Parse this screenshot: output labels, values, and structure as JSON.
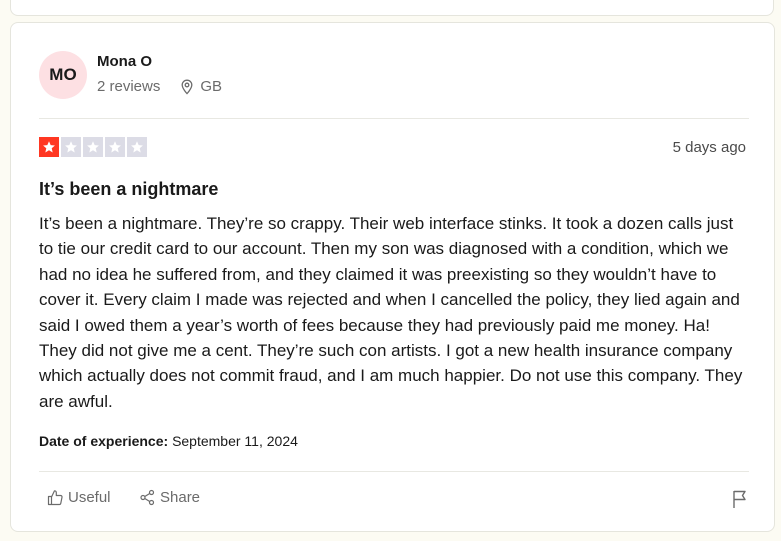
{
  "reviewer": {
    "initials": "MO",
    "name": "Mona O",
    "reviews": "2 reviews",
    "country": "GB"
  },
  "review": {
    "rating": 1,
    "rating_max": 5,
    "posted": "5 days ago",
    "title": "It’s been a nightmare",
    "body": "It’s been a nightmare. They’re so crappy. Their web interface stinks. It took a dozen calls just to tie our credit card to our account. Then my son was diagnosed with a condition, which we had no idea he suffered from, and they claimed it was preexisting so they wouldn’t have to cover it. Every claim I made was rejected and when I cancelled the policy, they lied again and said I owed them a year’s worth of fees because they had previously paid me money. Ha! They did not give me a cent. They’re such con artists. I got a new health insurance company which actually does not commit fraud, and I am much happier. Do not use this company. They are awful.",
    "experience_label": "Date of experience:",
    "experience_date": "September 11, 2024"
  },
  "actions": {
    "useful_label": "Useful",
    "share_label": "Share"
  },
  "colors": {
    "star_filled": "#ff3722",
    "star_empty": "#dcdce6",
    "avatar_bg": "#fde0e3"
  },
  "icons": {
    "location": "location-pin-icon",
    "useful": "thumbs-up-icon",
    "share": "share-icon",
    "flag": "flag-icon",
    "star": "star-icon"
  }
}
